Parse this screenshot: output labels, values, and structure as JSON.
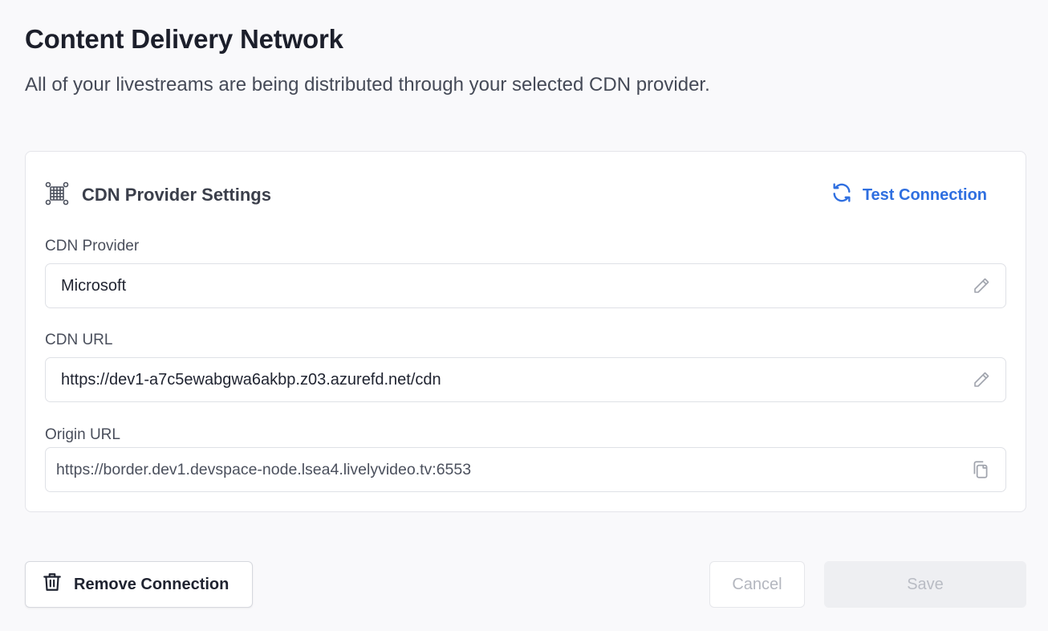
{
  "page": {
    "title": "Content Delivery Network",
    "subtitle": "All of your livestreams are being distributed through your selected CDN provider."
  },
  "card": {
    "title": "CDN Provider Settings",
    "icon": "network-icon",
    "test_connection_label": "Test Connection",
    "test_connection_icon": "refresh-icon"
  },
  "fields": {
    "provider": {
      "label": "CDN Provider",
      "value": "Microsoft",
      "icon": "pencil-icon"
    },
    "cdn_url": {
      "label": "CDN URL",
      "value": "https://dev1-a7c5ewabgwa6akbp.z03.azurefd.net/cdn",
      "icon": "pencil-icon"
    },
    "origin_url": {
      "label": "Origin URL",
      "value": "https://border.dev1.devspace-node.lsea4.livelyvideo.tv:6553",
      "icon": "copy-icon"
    }
  },
  "actions": {
    "remove_label": "Remove Connection",
    "remove_icon": "trash-icon",
    "cancel_label": "Cancel",
    "save_label": "Save"
  },
  "colors": {
    "accent": "#2f6fe0",
    "background": "#f9f9fb",
    "disabled_text": "#b9bcc4"
  }
}
